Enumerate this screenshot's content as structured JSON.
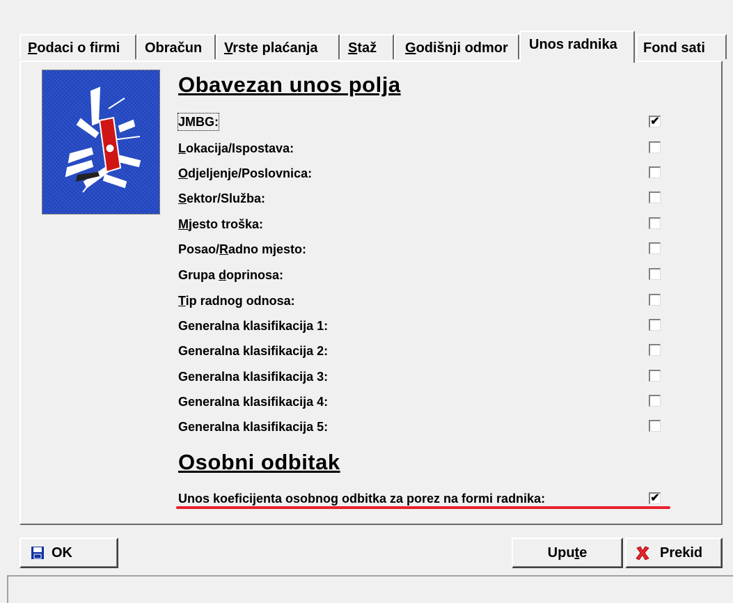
{
  "tabs": [
    {
      "pre": "",
      "u": "P",
      "post": "odaci o firmi"
    },
    {
      "pre": "Obra",
      "u": "",
      "post": "čun"
    },
    {
      "pre": "",
      "u": "V",
      "post": "rste plaćanja"
    },
    {
      "pre": "",
      "u": "S",
      "post": "taž"
    },
    {
      "pre": "",
      "u": "G",
      "post": "odišnji odmor"
    },
    {
      "pre": "Unos radnika",
      "u": "",
      "post": ""
    },
    {
      "pre": "Fond sati",
      "u": "",
      "post": ""
    }
  ],
  "section1": {
    "title": "Obavezan unos polja"
  },
  "section2": {
    "title": "Osobni odbitak"
  },
  "fields": [
    {
      "pre": "",
      "u": "",
      "post": "JMBG:",
      "checked": true
    },
    {
      "pre": "",
      "u": "L",
      "post": "okacija/Ispostava:",
      "checked": false
    },
    {
      "pre": "",
      "u": "O",
      "post": "djeljenje/Poslovnica:",
      "checked": false
    },
    {
      "pre": "",
      "u": "S",
      "post": "ektor/Služba:",
      "checked": false
    },
    {
      "pre": "",
      "u": "M",
      "post": "jesto troška:",
      "checked": false
    },
    {
      "pre": "Posao/",
      "u": "R",
      "post": "adno mjesto:",
      "checked": false
    },
    {
      "pre": "Grupa ",
      "u": "d",
      "post": "oprinosa:",
      "checked": false
    },
    {
      "pre": "",
      "u": "T",
      "post": "ip radnog odnosa:",
      "checked": false
    },
    {
      "pre": "Generalna klasifikacija 1:",
      "u": "",
      "post": "",
      "checked": false
    },
    {
      "pre": "Generalna klasifikacija 2:",
      "u": "",
      "post": "",
      "checked": false
    },
    {
      "pre": "Generalna klasifikacija 3:",
      "u": "",
      "post": "",
      "checked": false
    },
    {
      "pre": "Generalna klasifikacija 4:",
      "u": "",
      "post": "",
      "checked": false
    },
    {
      "pre": "Generalna klasifikacija 5:",
      "u": "",
      "post": "",
      "checked": false
    }
  ],
  "deduction": {
    "label": "Unos koeficijenta osobnog odbitka za porez na formi radnika:",
    "checked": true
  },
  "buttons": {
    "ok": "OK",
    "help": {
      "pre": "Upu",
      "u": "t",
      "post": "e"
    },
    "cancel": "Prekid"
  },
  "icons": {
    "ok": "floppy-disk-icon",
    "cancel": "red-x-icon",
    "logo": "swiss-army-knife-logo"
  },
  "colors": {
    "logo_bg": "#2349c8",
    "highlight": "#e8222e",
    "cancel_icon": "#e8222e",
    "floppy": "#1030a0"
  }
}
